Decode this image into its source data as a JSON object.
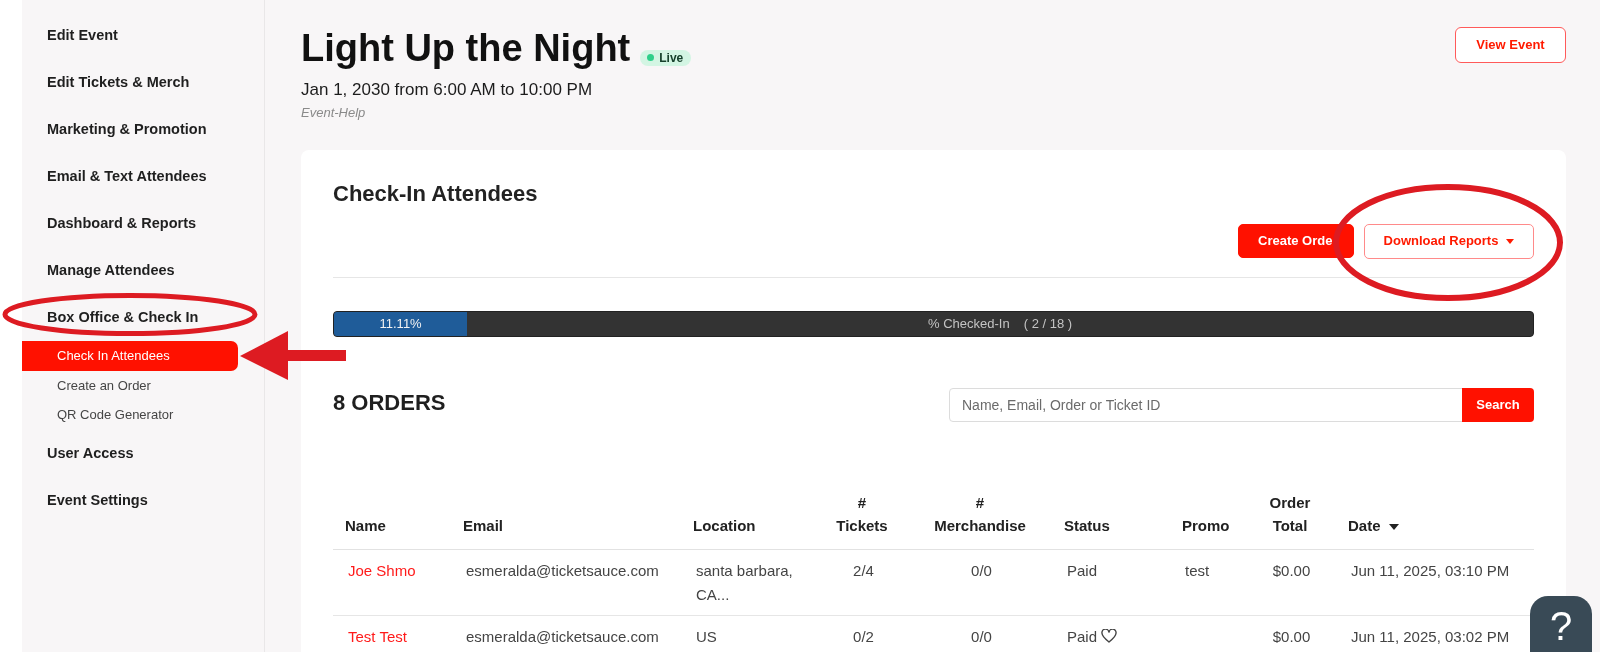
{
  "sidebar": {
    "items": [
      {
        "label": "Edit Event",
        "selected": false
      },
      {
        "label": "Edit Tickets & Merch",
        "selected": false
      },
      {
        "label": "Marketing & Promotion",
        "selected": false
      },
      {
        "label": "Email & Text Attendees",
        "selected": false
      },
      {
        "label": "Dashboard & Reports",
        "selected": false
      },
      {
        "label": "Manage Attendees",
        "selected": false
      },
      {
        "label": "Box Office & Check In",
        "selected": false,
        "children": [
          {
            "label": "Check In Attendees",
            "selected": true
          },
          {
            "label": "Create an Order",
            "selected": false
          },
          {
            "label": "QR Code Generator",
            "selected": false
          }
        ]
      },
      {
        "label": "User Access",
        "selected": false
      },
      {
        "label": "Event Settings",
        "selected": false
      }
    ]
  },
  "event": {
    "title": "Light Up the Night",
    "status": "Live",
    "schedule": "Jan 1, 2030 from 6:00 AM to 10:00 PM",
    "category": "Event-Help",
    "action": "View Event"
  },
  "checkin_panel": {
    "title": "Check-In Attendees",
    "buttons": [
      {
        "label": "Create Orde",
        "kind": "primary",
        "dropdown": false
      },
      {
        "label": "Download Reports",
        "kind": "outline",
        "dropdown": true
      }
    ],
    "progress": {
      "level": 0.1111,
      "percent": "11.11%",
      "label": "% Checked-In",
      "count": "( 2 / 18 )"
    }
  },
  "orders": {
    "heading": "8 ORDERS",
    "search": {
      "placeholder": "Name, Email, Order or Ticket ID",
      "button": "Search"
    },
    "table": {
      "columns": [
        {
          "label": "Name",
          "sorted": false
        },
        {
          "label": "Email",
          "sorted": false
        },
        {
          "label": "Location",
          "sorted": false
        },
        {
          "label": "# Tickets",
          "sorted": false
        },
        {
          "label": "# Merchandise",
          "sorted": false
        },
        {
          "label": "Status",
          "sorted": false
        },
        {
          "label": "Promo",
          "sorted": false
        },
        {
          "label": "Order Total",
          "sorted": false
        },
        {
          "label": "Date",
          "sorted": true
        }
      ],
      "rows": [
        {
          "name": "Joe Shmo",
          "email": "esmeralda@ticketsauce.com",
          "location": "santa barbara, CA...",
          "tickets": "2/4",
          "merchandise": "0/0",
          "status": "Paid",
          "liked": false,
          "promo": "test",
          "total": "$0.00",
          "date": "Jun 11, 2025, 03:10 PM"
        },
        {
          "name": "Test Test",
          "email": "esmeralda@ticketsauce.com",
          "location": "US",
          "tickets": "0/2",
          "merchandise": "0/0",
          "status": "Paid",
          "liked": true,
          "total": "$0.00",
          "date": "Jun 11, 2025, 03:02 PM"
        }
      ]
    }
  },
  "help_button": "?"
}
